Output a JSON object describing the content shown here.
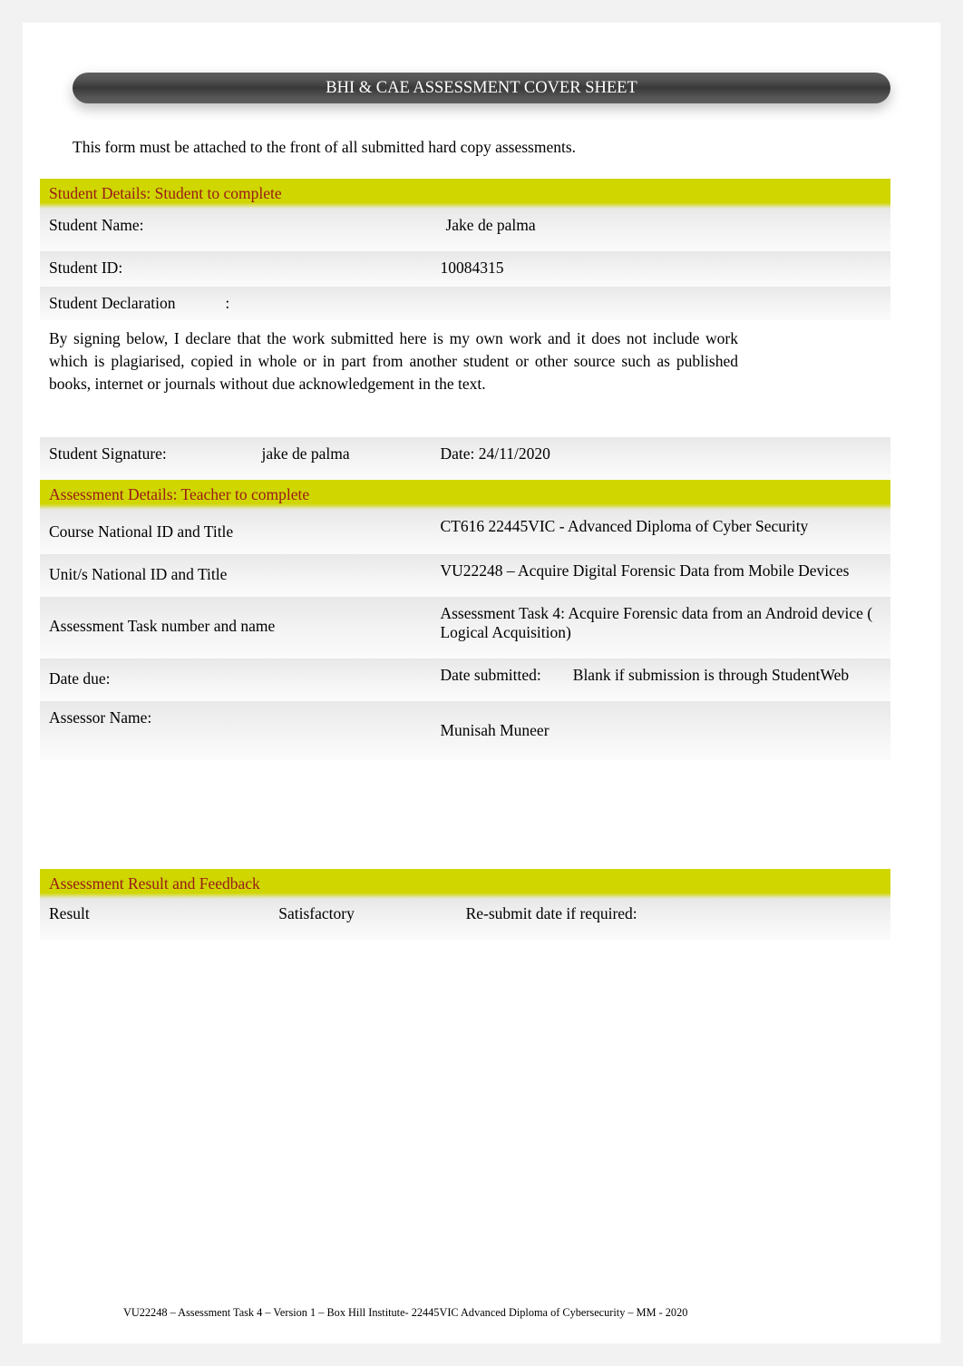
{
  "title": "BHI & CAE ASSESSMENT COVER SHEET",
  "intro": "This form must be attached to the front of all submitted hard copy assessments.",
  "student_section_header": "Student Details: Student to complete",
  "student": {
    "name_label": "Student Name:",
    "name_value": "Jake de palma",
    "id_label": "Student ID:",
    "id_value": "10084315",
    "declaration_label": "Student Declaration",
    "declaration_colon": ":",
    "declaration_text": "By signing below, I declare that the work submitted here is my own work and it does not include work which is plagiarised, copied in whole or in part from another student or other source such as published books, internet or journals without due acknowledgement in the text.",
    "signature_label": "Student Signature:",
    "signature_value": "jake de palma",
    "signature_date": "Date: 24/11/2020"
  },
  "assessment_section_header": "Assessment Details: Teacher to complete",
  "assessment": {
    "course_label": "Course National ID and Title",
    "course_value": "CT616 22445VIC - Advanced Diploma of Cyber Security",
    "unit_label": "Unit/s National ID and Title",
    "unit_value": "VU22248 – Acquire Digital Forensic Data from Mobile Devices",
    "task_label": "Assessment Task number and name",
    "task_value": "Assessment Task 4: Acquire Forensic data from an Android device ( Logical Acquisition)",
    "date_due_label": "Date due:",
    "date_submitted_value": "Date submitted:        Blank if submission is through StudentWeb",
    "assessor_label": "Assessor Name:",
    "assessor_value": "Munisah Muneer"
  },
  "result_section_header": "Assessment Result and Feedback",
  "result": {
    "result_label": "Result",
    "result_value": "Satisfactory",
    "resubmit_label": "Re-submit date if required:",
    "resubmit_value": ""
  },
  "footer": "VU22248 – Assessment Task 4 – Version 1 – Box Hill Institute- 22445VIC Advanced Diploma of Cybersecurity – MM - 2020"
}
